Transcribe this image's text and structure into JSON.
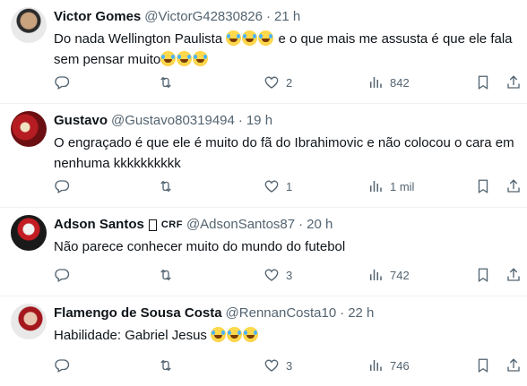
{
  "tweets": [
    {
      "name": "Victor Gomes",
      "handle": "@VictorG42830826",
      "time": "21 h",
      "text_lines": [
        {
          "pre": "Do nada Wellington Paulista ",
          "emojis": 3,
          "post": " e o que mais me assusta é que ele fala"
        },
        {
          "pre": "sem pensar muito",
          "emojis": 3,
          "post": ""
        }
      ],
      "replies": "",
      "retweets": "",
      "likes": "2",
      "views": "842"
    },
    {
      "name": "Gustavo",
      "handle": "@Gustavo80319494",
      "time": "19 h",
      "text_lines": [
        {
          "pre": "O engraçado é que ele é muito do fã do Ibrahimovic e não colocou o cara em",
          "emojis": 0,
          "post": ""
        },
        {
          "pre": "nenhuma kkkkkkkkkk",
          "emojis": 0,
          "post": ""
        }
      ],
      "replies": "",
      "retweets": "",
      "likes": "1",
      "views": "1 mil"
    },
    {
      "name": "Adson Santos",
      "name_suffix": "CRF",
      "handle": "@AdsonSantos87",
      "time": "20 h",
      "text_lines": [
        {
          "pre": "Não parece conhecer muito do mundo do futebol",
          "emojis": 0,
          "post": ""
        }
      ],
      "replies": "",
      "retweets": "",
      "likes": "3",
      "views": "742"
    },
    {
      "name": "Flamengo de Sousa Costa",
      "handle": "@RennanCosta10",
      "time": "22 h",
      "text_lines": [
        {
          "pre": "Habilidade: Gabriel Jesus ",
          "emojis": 3,
          "post": ""
        }
      ],
      "replies": "",
      "retweets": "",
      "likes": "3",
      "views": "746"
    }
  ],
  "separator": "·",
  "icons": [
    "reply-icon",
    "retweet-icon",
    "like-icon",
    "views-icon",
    "bookmark-icon",
    "share-icon"
  ],
  "colors": {
    "secondary_text": "#536471",
    "primary_text": "#0f1419",
    "divider": "#eff3f4"
  }
}
